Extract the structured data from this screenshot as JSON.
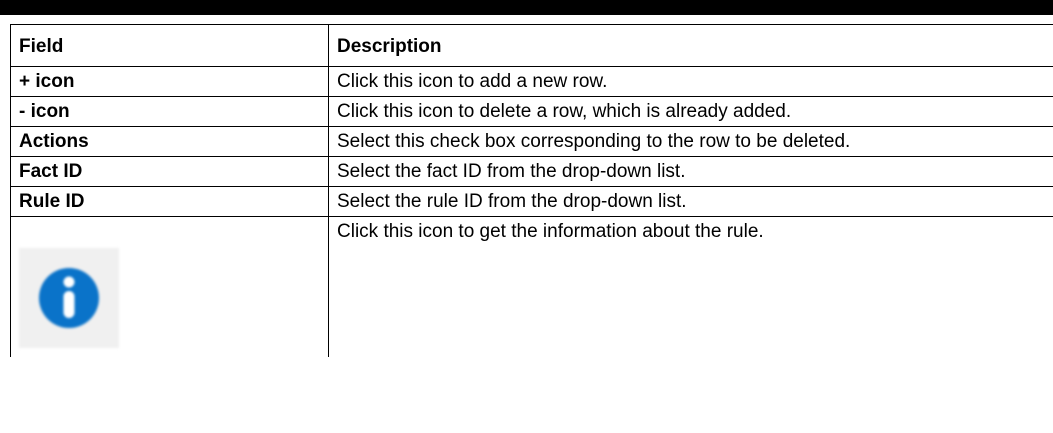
{
  "table": {
    "headers": {
      "field": "Field",
      "description": "Description"
    },
    "rows": [
      {
        "field": "+ icon",
        "description": "Click this icon to add a new row."
      },
      {
        "field": "- icon",
        "description": "Click this icon to delete a row, which is already added."
      },
      {
        "field": "Actions",
        "description": "Select this check box corresponding to the row to be deleted."
      },
      {
        "field": "Fact ID",
        "description": "Select the fact ID from the drop-down list."
      },
      {
        "field": "Rule ID",
        "description": "Select the rule ID from the drop-down list."
      }
    ],
    "info_row": {
      "icon": "info-icon",
      "description": "Click this icon to get the information about the rule."
    }
  },
  "colors": {
    "info_icon": "#0a73c9",
    "top_bar": "#000000"
  }
}
